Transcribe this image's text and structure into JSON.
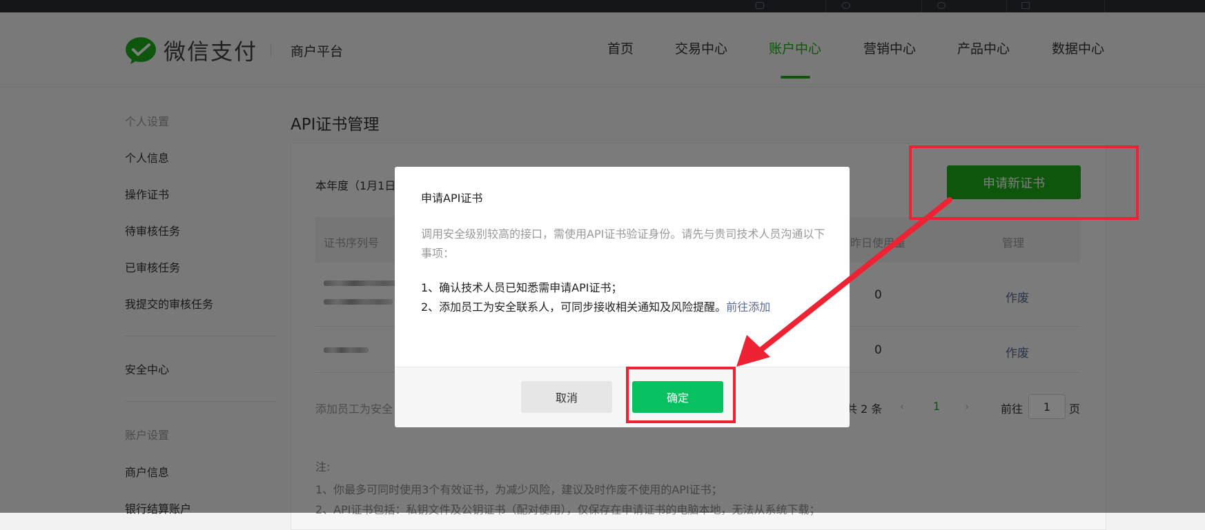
{
  "header": {
    "brand": "微信支付",
    "platform": "商户平台",
    "nav": [
      {
        "label": "首页"
      },
      {
        "label": "交易中心"
      },
      {
        "label": "账户中心",
        "active": true
      },
      {
        "label": "营销中心"
      },
      {
        "label": "产品中心"
      },
      {
        "label": "数据中心"
      }
    ]
  },
  "sidebar": {
    "personal_group": "个人设置",
    "items": [
      "个人信息",
      "操作证书",
      "待审核任务",
      "已审核任务",
      "我提交的审核任务"
    ],
    "security": "安全中心",
    "account_group": "账户设置",
    "account_items": [
      "商户信息",
      "银行结算账户"
    ]
  },
  "main": {
    "title": "API证书管理",
    "year_text": "本年度（1月1日",
    "apply_button": "申请新证书",
    "table": {
      "headers": [
        "证书序列号",
        "昨日使用量",
        "管理"
      ],
      "rows": [
        {
          "usage": "0",
          "action": "作废"
        },
        {
          "usage": "0",
          "action": "作废"
        }
      ]
    },
    "footer_text": "添加员工为安全",
    "pagination": {
      "total": "共 2 条",
      "prev": "‹",
      "current": "1",
      "next": "›",
      "goto": "前往",
      "page_value": "1",
      "page_suffix": "页"
    },
    "notes": {
      "label": "注:",
      "line1": "1、你最多可同时使用3个有效证书，为减少风险，建议及时作废不使用的API证书；",
      "line2": "2、API证书包括：私钥文件及公钥证书（配对使用），仅保存在申请证书的电脑本地，无法从系统下载；"
    }
  },
  "modal": {
    "title": "申请API证书",
    "description": "调用安全级别较高的接口，需使用API证书验证身份。请先与贵司技术人员沟通以下事项：",
    "item1": "1、确认技术人员已知悉需申请API证书；",
    "item2": "2、添加员工为安全联系人，可同步接收相关通知及风险提醒。",
    "item2_link": "前往添加",
    "cancel": "取消",
    "confirm": "确定"
  },
  "colors": {
    "brand_green": "#1aad19",
    "confirm_green": "#07c160",
    "link_blue": "#576b95",
    "annotation_red": "#ee2233"
  }
}
